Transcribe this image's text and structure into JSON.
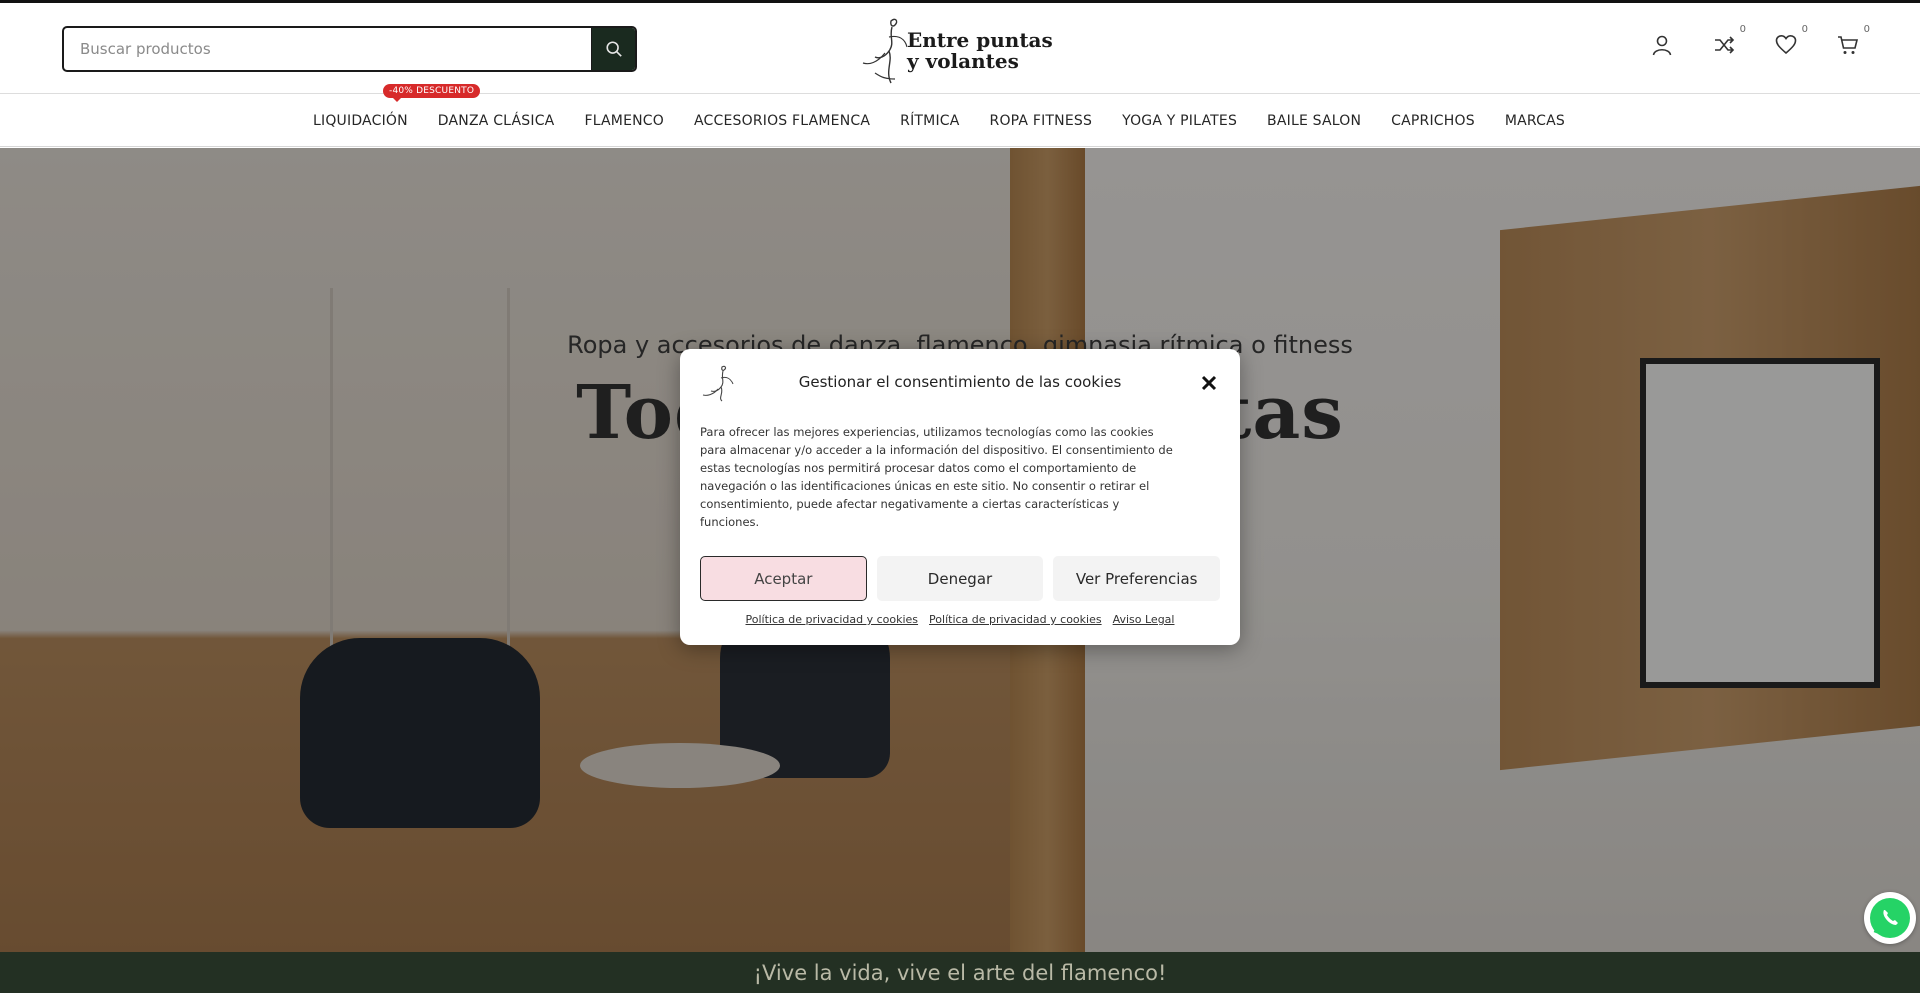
{
  "header": {
    "search": {
      "placeholder": "Buscar productos"
    },
    "logo": {
      "line1": "Entre puntas",
      "line2": "y volantes"
    },
    "icons": [
      {
        "name": "account-icon"
      },
      {
        "name": "compare-icon",
        "count": "0"
      },
      {
        "name": "wishlist-icon",
        "count": "0"
      },
      {
        "name": "cart-icon",
        "count": "0"
      }
    ]
  },
  "nav": {
    "items": [
      {
        "label": "LIQUIDACIÓN",
        "badge": "-40% DESCUENTO"
      },
      {
        "label": "DANZA CLÁSICA"
      },
      {
        "label": "FLAMENCO"
      },
      {
        "label": "ACCESORIOS FLAMENCA"
      },
      {
        "label": "RÍTMICA"
      },
      {
        "label": "ROPA FITNESS"
      },
      {
        "label": "YOGA Y PILATES"
      },
      {
        "label": "BAILE SALON"
      },
      {
        "label": "CAPRICHOS"
      },
      {
        "label": "MARCAS"
      }
    ]
  },
  "hero": {
    "subtitle": "Ropa y accesorios de danza, flamenco, gimnasia rítmica o fitness",
    "title": "Todo para artistas"
  },
  "bottom_bar": {
    "text": "¡Vive la vida, vive el arte del flamenco!"
  },
  "cookie_modal": {
    "title": "Gestionar el consentimiento de las cookies",
    "body": "Para ofrecer las mejores experiencias, utilizamos tecnologías como las cookies para almacenar y/o acceder a la información del dispositivo. El consentimiento de estas tecnologías nos permitirá procesar datos como el comportamiento de navegación o las identificaciones únicas en este sitio. No consentir o retirar el consentimiento, puede afectar negativamente a ciertas características y funciones.",
    "buttons": {
      "accept": "Aceptar",
      "deny": "Denegar",
      "preferences": "Ver Preferencias"
    },
    "links": [
      "Política de privacidad y cookies",
      "Política de privacidad y cookies",
      "Aviso Legal"
    ]
  },
  "colors": {
    "accent_pink": "#f8dde2",
    "dark_green": "#233023",
    "badge_red": "#d72a2a"
  }
}
